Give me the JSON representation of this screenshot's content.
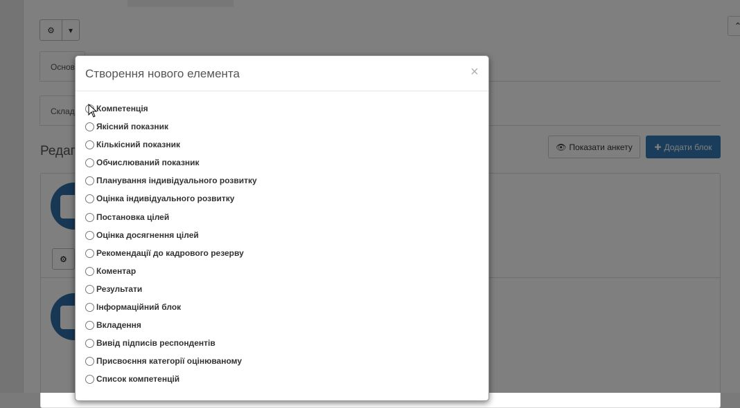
{
  "background_page": {
    "tab_row_1": {
      "active_tab_label": "Основ"
    },
    "tab_row_2": {
      "active_tab_label": "Склад"
    },
    "section_title": "Редагу",
    "show_form_button": {
      "icon": "eye-icon",
      "label": "Показати анкету"
    },
    "add_block_button": {
      "icon": "plus-icon",
      "label": "Додати блок"
    },
    "accent_color": "#337ab7"
  },
  "modal": {
    "title": "Створення нового елемента",
    "close_label": "×",
    "options": [
      {
        "label": "Компетенція"
      },
      {
        "label": "Якісний показник"
      },
      {
        "label": "Кількісний показник"
      },
      {
        "label": "Обчислюваний показник"
      },
      {
        "label": "Планування індивідуального розвитку"
      },
      {
        "label": "Оцінка індивідуального розвитку"
      },
      {
        "label": "Постановка цілей"
      },
      {
        "label": "Оцінка досягнення цілей"
      },
      {
        "label": "Рекомендації до кадрового резерву"
      },
      {
        "label": "Коментар"
      },
      {
        "label": "Результати"
      },
      {
        "label": "Інформаційний блок"
      },
      {
        "label": "Вкладення"
      },
      {
        "label": "Вивід підписів респондентів"
      },
      {
        "label": "Присвоєння категорії оцінюваному"
      },
      {
        "label": "Список компетенцій"
      }
    ]
  }
}
